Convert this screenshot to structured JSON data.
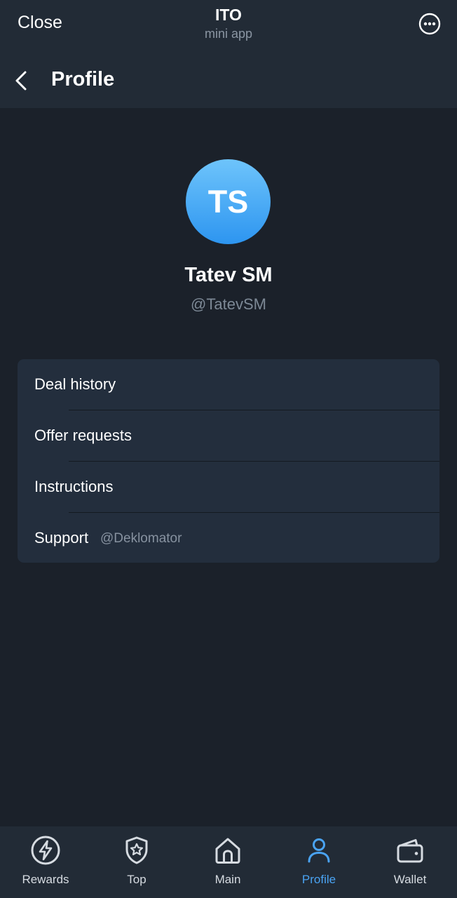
{
  "topbar": {
    "close_label": "Close",
    "app_title": "ITO",
    "app_subtitle": "mini app",
    "more_icon": "more-horizontal-circle-icon"
  },
  "header": {
    "back_icon": "chevron-left-icon",
    "title": "Profile"
  },
  "profile": {
    "initials": "TS",
    "name": "Tatev SM",
    "handle": "@TatevSM",
    "avatar_color": "#3aa0f3"
  },
  "menu": {
    "items": [
      {
        "label": "Deal history"
      },
      {
        "label": "Offer requests"
      },
      {
        "label": "Instructions"
      },
      {
        "label": "Support",
        "sub": "@Deklomator"
      }
    ]
  },
  "bottom_nav": {
    "active": "Profile",
    "accent_color": "#4aa3f2",
    "items": [
      {
        "label": "Rewards",
        "icon": "lightning-circle-icon"
      },
      {
        "label": "Top",
        "icon": "star-shield-icon"
      },
      {
        "label": "Main",
        "icon": "home-icon"
      },
      {
        "label": "Profile",
        "icon": "person-icon"
      },
      {
        "label": "Wallet",
        "icon": "wallet-icon"
      }
    ]
  }
}
